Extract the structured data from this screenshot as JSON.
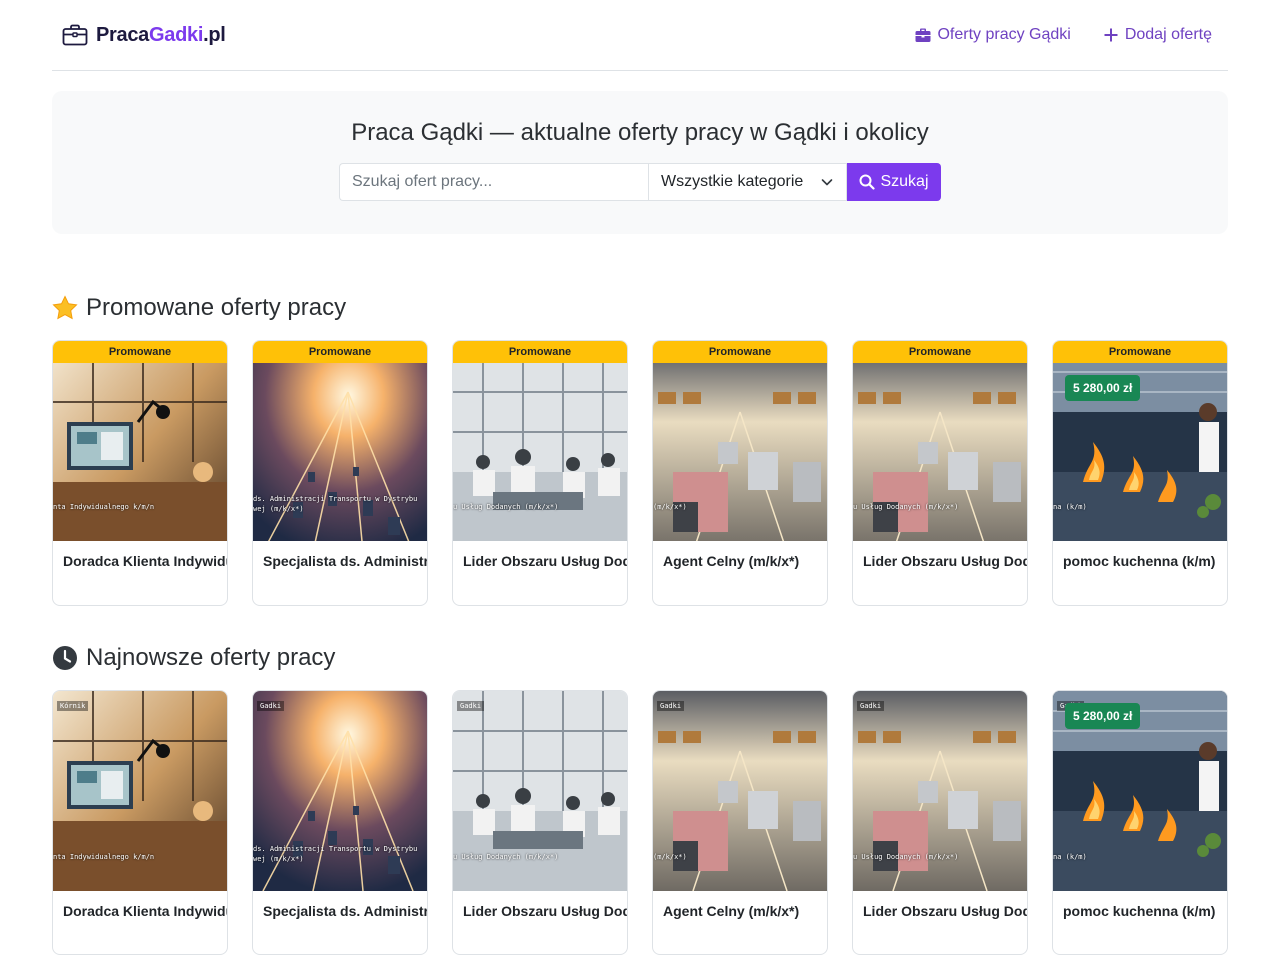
{
  "header": {
    "logo": {
      "part1": "Praca",
      "part2": "Gadki",
      "part3": ".pl"
    },
    "nav": [
      {
        "label": "Oferty pracy Gądki",
        "icon": "briefcase-icon"
      },
      {
        "label": "Dodaj ofertę",
        "icon": "plus-icon"
      }
    ]
  },
  "hero": {
    "title": "Praca Gądki — aktualne oferty pracy w Gądki i okolicy",
    "search_placeholder": "Szukaj ofert pracy...",
    "category_selected": "Wszystkie kategorie",
    "search_button": "Szukaj"
  },
  "promoted": {
    "title": "Promowane oferty pracy",
    "icon": "star-icon",
    "band_label": "Promowane",
    "cards": [
      {
        "title": "Doradca Klienta Indywidualnego k/m/n",
        "caption": "nta Indywidualnego k/m/n",
        "salary": "",
        "scene": "office"
      },
      {
        "title": "Specjalista ds. Administracji Transportu w Dystrybucji",
        "caption": "ds. Administracji Transportu w Dystrybu",
        "caption2": "wej (m/k/x*)",
        "salary": "",
        "scene": "road"
      },
      {
        "title": "Lider Obszaru Usług Dodanych (m/k/x*)",
        "caption": "u Usług Dodanych (m/k/x*)",
        "salary": "",
        "scene": "team"
      },
      {
        "title": "Agent Celny (m/k/x*)",
        "caption": "(m/k/x*)",
        "salary": "",
        "scene": "trucks"
      },
      {
        "title": "Lider Obszaru Usług Dodanych (m/k/x*)",
        "caption": "u Usług Dodanych (m/k/x*)",
        "salary": "",
        "scene": "trucks"
      },
      {
        "title": "pomoc kuchenna (k/m)",
        "caption": "na (k/m)",
        "salary": "5 280,00 zł",
        "scene": "kitchen"
      }
    ]
  },
  "newest": {
    "title": "Najnowsze oferty pracy",
    "icon": "clock-icon",
    "cards": [
      {
        "title": "Doradca Klienta Indywidualnego k/m/n",
        "location": "Kórnik",
        "caption": "nta Indywidualnego k/m/n",
        "salary": "",
        "scene": "office"
      },
      {
        "title": "Specjalista ds. Administracji Transportu w Dystrybucji",
        "location": "Gadki",
        "caption": "ds. Administracji Transportu w Dystrybu",
        "caption2": "wej (m/k/x*)",
        "salary": "",
        "scene": "road"
      },
      {
        "title": "Lider Obszaru Usług Dodanych (m/k/x*)",
        "location": "Gadki",
        "caption": "u Usług Dodanych (m/k/x*)",
        "salary": "",
        "scene": "team"
      },
      {
        "title": "Agent Celny (m/k/x*)",
        "location": "Gadki",
        "caption": "(m/k/x*)",
        "salary": "",
        "scene": "trucks"
      },
      {
        "title": "Lider Obszaru Usług Dodanych (m/k/x*)",
        "location": "Gadki",
        "caption": "u Usług Dodanych (m/k/x*)",
        "salary": "",
        "scene": "trucks"
      },
      {
        "title": "pomoc kuchenna (k/m)",
        "location": "Gadki",
        "caption": "na (k/m)",
        "salary": "5 280,00 zł",
        "scene": "kitchen"
      }
    ]
  },
  "colors": {
    "accent": "#7c3aed",
    "promo": "#ffc107",
    "salary": "#198754"
  }
}
